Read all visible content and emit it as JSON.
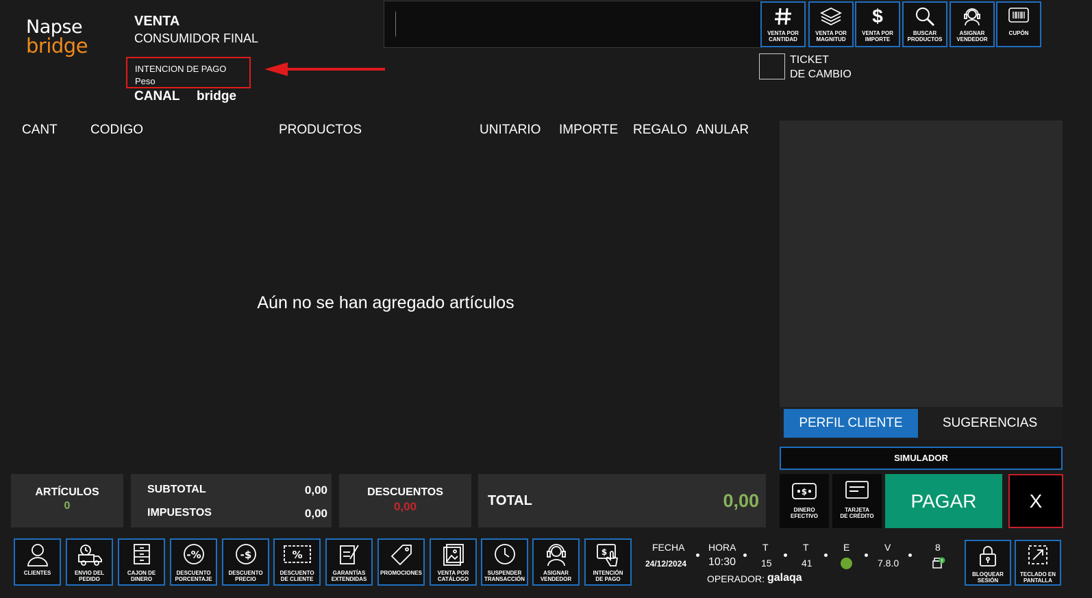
{
  "logo": {
    "line1": "Napse",
    "line2": "bridge"
  },
  "header": {
    "sale_type": "VENTA",
    "customer": "CONSUMIDOR FINAL",
    "intent_label": "INTENCION DE PAGO",
    "intent_value": "Peso",
    "canal_label": "CANAL",
    "canal_value": "bridge"
  },
  "search": {
    "value": "",
    "placeholder": ""
  },
  "toolbar": [
    {
      "label": "VENTA POR CANTIDAD",
      "icon": "hash-icon"
    },
    {
      "label": "VENTA POR MAGNITUD",
      "icon": "layers-icon"
    },
    {
      "label": "VENTA POR IMPORTE",
      "icon": "dollar-icon"
    },
    {
      "label": "BUSCAR PRODUCTOS",
      "icon": "search-icon"
    },
    {
      "label": "ASIGNAR VENDEDOR",
      "icon": "headset-icon"
    },
    {
      "label": "CUPÓN",
      "icon": "barcode-icon"
    }
  ],
  "ticket": {
    "label_line1": "TICKET",
    "label_line2": "DE CAMBIO"
  },
  "table": {
    "headers": [
      "CANT",
      "CODIGO",
      "PRODUCTOS",
      "UNITARIO",
      "IMPORTE",
      "REGALO",
      "ANULAR"
    ],
    "empty_message": "Aún no se han agregado artículos"
  },
  "side": {
    "tab_profile": "PERFIL CLIENTE",
    "tab_suggestions": "SUGERENCIAS",
    "simulator": "SIMULADOR"
  },
  "payment": {
    "cash_line1": "DINERO",
    "cash_line2": "EFECTIVO",
    "card_line1": "TARJETA",
    "card_line2": "DE CRÉDITO",
    "pay": "PAGAR",
    "cancel": "X"
  },
  "summary": {
    "articles_label": "ARTÍCULOS",
    "articles_value": "0",
    "subtotal_label": "SUBTOTAL",
    "subtotal_value": "0,00",
    "taxes_label": "IMPUESTOS",
    "taxes_value": "0,00",
    "discounts_label": "DESCUENTOS",
    "discounts_value": "0,00",
    "total_label": "TOTAL",
    "total_value": "0,00"
  },
  "functions": [
    {
      "line1": "CLIENTES",
      "line2": "",
      "icon": "user-icon"
    },
    {
      "line1": "ENVIO DEL",
      "line2": "PEDIDO",
      "icon": "truck-icon"
    },
    {
      "line1": "CAJON DE",
      "line2": "DINERO",
      "icon": "drawer-icon"
    },
    {
      "line1": "DESCUENTO",
      "line2": "PORCENTAJE",
      "icon": "percent-icon"
    },
    {
      "line1": "DESCUENTO",
      "line2": "PRECIO",
      "icon": "price-discount-icon"
    },
    {
      "line1": "DESCUENTO",
      "line2": "DE CLIENTE",
      "icon": "coupon-icon"
    },
    {
      "line1": "GARANTÍAS",
      "line2": "EXTENDIDAS",
      "icon": "document-pen-icon"
    },
    {
      "line1": "PROMOCIONES",
      "line2": "",
      "icon": "tag-icon"
    },
    {
      "line1": "VENTA POR",
      "line2": "CATÁLOGO",
      "icon": "catalog-icon"
    },
    {
      "line1": "SUSPENDER",
      "line2": "TRANSACCIÓN",
      "icon": "clock-icon"
    },
    {
      "line1": "ASIGNAR",
      "line2": "VENDEDOR",
      "icon": "headset-icon"
    },
    {
      "line1": "INTENCIÓN",
      "line2": "DE PAGO",
      "icon": "payment-intent-icon"
    }
  ],
  "status": {
    "date_label": "FECHA",
    "date_value": "24/12/2024",
    "time_label": "HORA",
    "time_value": "10:30",
    "t1_label": "T",
    "t1_value": "15",
    "t2_label": "T",
    "t2_value": "41",
    "e_label": "E",
    "v_label": "V",
    "v_value": "7.8.0",
    "count_label": "8",
    "operator_label": "OPERADOR:",
    "operator_value": "galaqa"
  },
  "right_functions": [
    {
      "line1": "BLOQUEAR",
      "line2": "SESIÓN",
      "icon": "lock-icon"
    },
    {
      "line1": "TECLADO EN",
      "line2": "PANTALLA",
      "icon": "expand-icon"
    }
  ],
  "colors": {
    "accent": "#1e6fc0",
    "pay": "#0a9670",
    "alert": "#e11b1b",
    "positive": "#88b25a",
    "negative": "#c4262e",
    "brand": "#f08a1c"
  }
}
